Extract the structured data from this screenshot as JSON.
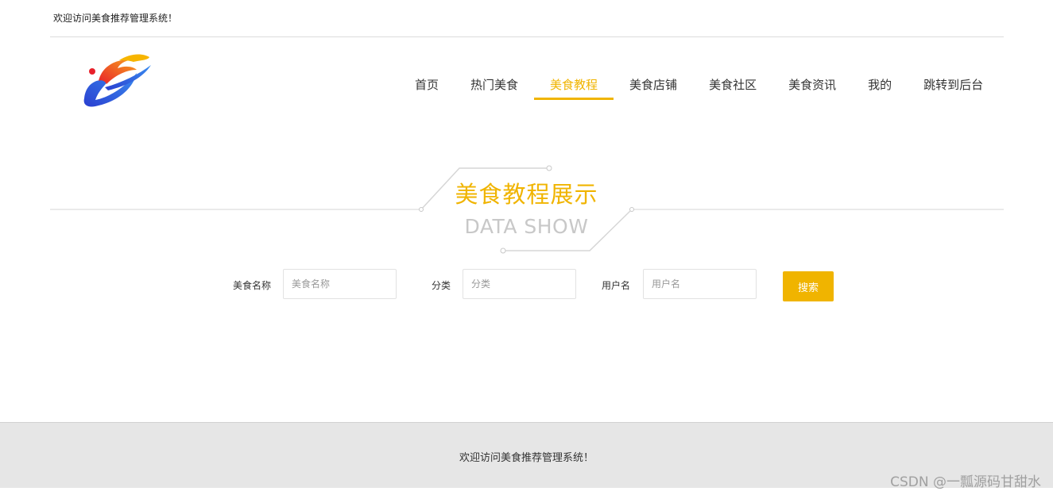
{
  "header": {
    "welcome_text": "欢迎访问美食推荐管理系统！"
  },
  "nav": {
    "items": [
      {
        "label": "首页",
        "active": false
      },
      {
        "label": "热门美食",
        "active": false
      },
      {
        "label": "美食教程",
        "active": true
      },
      {
        "label": "美食店铺",
        "active": false
      },
      {
        "label": "美食社区",
        "active": false
      },
      {
        "label": "美食资讯",
        "active": false
      },
      {
        "label": "我的",
        "active": false
      },
      {
        "label": "跳转到后台",
        "active": false
      }
    ]
  },
  "section": {
    "title": "美食教程展示",
    "subtitle": "DATA SHOW"
  },
  "search": {
    "fields": [
      {
        "label": "美食名称",
        "placeholder": "美食名称",
        "value": ""
      },
      {
        "label": "分类",
        "placeholder": "分类",
        "value": ""
      },
      {
        "label": "用户名",
        "placeholder": "用户名",
        "value": ""
      }
    ],
    "button_label": "搜索"
  },
  "footer": {
    "text": "欢迎访问美食推荐管理系统！"
  },
  "watermark": "CSDN @一瓢源码甘甜水",
  "colors": {
    "accent": "#f0b400",
    "footer_bg": "#e6e6e6",
    "subtitle_gray": "#c8c8c8"
  },
  "icons": {
    "logo": "logo-icon"
  }
}
